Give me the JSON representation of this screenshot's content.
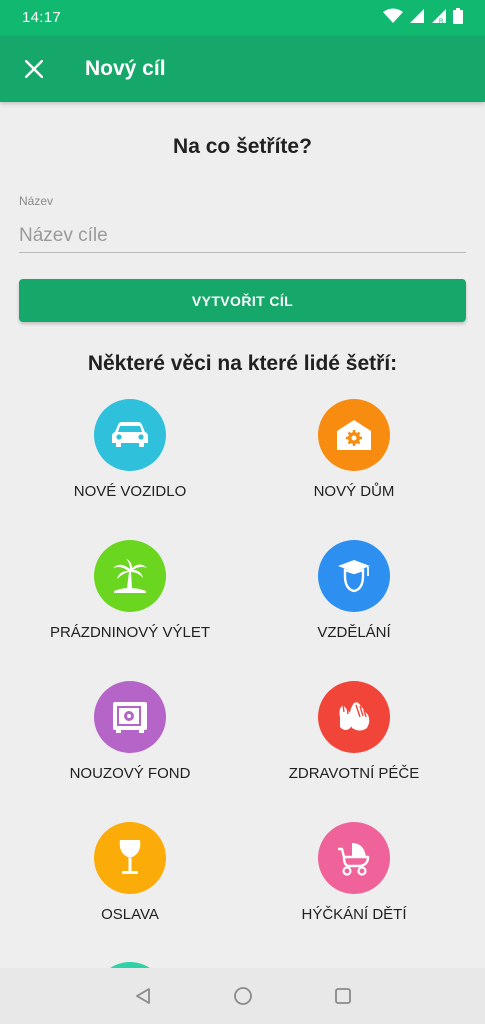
{
  "status_bar": {
    "time": "14:17"
  },
  "app_bar": {
    "title": "Nový cíl"
  },
  "form": {
    "heading": "Na co šetříte?",
    "name_label": "Název",
    "name_placeholder": "Název cíle",
    "name_value": "",
    "create_button": "VYTVOŘIT CÍL"
  },
  "suggestions": {
    "title": "Některé věci na které lidé šetří:",
    "items": [
      {
        "label": "NOVÉ VOZIDLO",
        "icon": "car-icon",
        "color": "#2fc0dc"
      },
      {
        "label": "NOVÝ DŮM",
        "icon": "house-icon",
        "color": "#f78c10"
      },
      {
        "label": "PRÁZDNINOVÝ VÝLET",
        "icon": "palm-tree-icon",
        "color": "#6ad61f"
      },
      {
        "label": "VZDĚLÁNÍ",
        "icon": "graduate-icon",
        "color": "#2d8ff0"
      },
      {
        "label": "NOUZOVÝ FOND",
        "icon": "safe-icon",
        "color": "#b565c8"
      },
      {
        "label": "ZDRAVOTNÍ PÉČE",
        "icon": "hands-icon",
        "color": "#f2453a"
      },
      {
        "label": "OSLAVA",
        "icon": "wine-glass-icon",
        "color": "#fbac08"
      },
      {
        "label": "HÝČKÁNÍ DĚTÍ",
        "icon": "stroller-icon",
        "color": "#f0629a"
      }
    ]
  },
  "colors": {
    "primary": "#15a86a",
    "status_bar": "#10b870",
    "background": "#eeeeee"
  }
}
